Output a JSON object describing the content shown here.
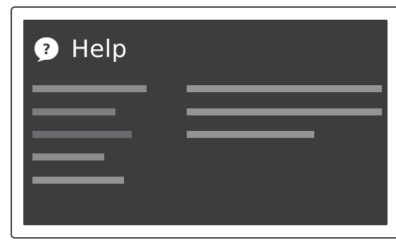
{
  "help": {
    "title": "Help",
    "icon": "help-bubble-icon"
  },
  "colors": {
    "panel_background": "#3d3d3d",
    "title_text": "#ffffff",
    "placeholder_line": "#8d8c8f"
  }
}
